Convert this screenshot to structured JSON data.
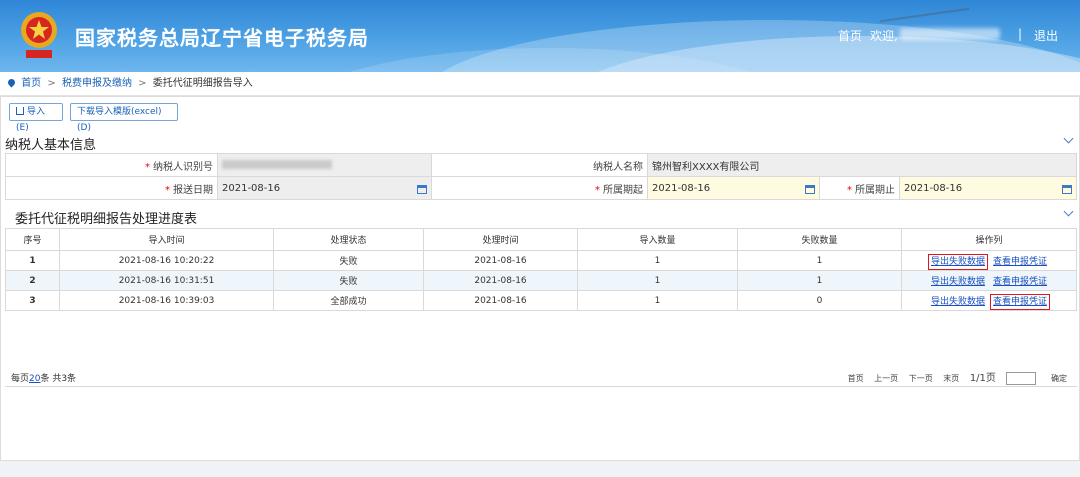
{
  "header": {
    "site_title": "国家税务总局辽宁省电子税务局",
    "nav": {
      "home": "首页",
      "welcome": "欢迎,",
      "separator": "|",
      "exit": "退出"
    }
  },
  "breadcrumb": {
    "items": [
      "首页",
      "税费申报及缴纳"
    ],
    "current": "委托代征明细报告导入"
  },
  "toolbar": {
    "import_label": "导入(E)",
    "template_label": "下载导入模版(excel)(D)"
  },
  "taxpayer_section": {
    "title": "纳税人基本信息",
    "taxpayer_id_label": "纳税人识别号",
    "taxpayer_name_label": "纳税人名称",
    "taxpayer_name_value": "锦州智利XXXX有限公司",
    "report_date_label": "报送日期",
    "report_date_value": "2021-08-16",
    "period_start_label": "所属期起",
    "period_start_value": "2021-08-16",
    "period_end_label": "所属期止",
    "period_end_value": "2021-08-16"
  },
  "progress_section": {
    "title": "委托代征税明细报告处理进度表",
    "columns": [
      "序号",
      "导入时间",
      "处理状态",
      "处理时间",
      "导入数量",
      "失败数量",
      "操作列"
    ],
    "rows": [
      {
        "idx": "1",
        "import_time": "2021-08-16 10:20:22",
        "status": "失败",
        "process_time": "2021-08-16",
        "import_count": "1",
        "fail_count": "1",
        "action1": "导出失败数据",
        "action2": "查看申报凭证"
      },
      {
        "idx": "2",
        "import_time": "2021-08-16 10:31:51",
        "status": "失败",
        "process_time": "2021-08-16",
        "import_count": "1",
        "fail_count": "1",
        "action1": "导出失败数据",
        "action2": "查看申报凭证"
      },
      {
        "idx": "3",
        "import_time": "2021-08-16 10:39:03",
        "status": "全部成功",
        "process_time": "2021-08-16",
        "import_count": "1",
        "fail_count": "0",
        "action1": "导出失败数据",
        "action2": "查看申报凭证"
      }
    ]
  },
  "pager": {
    "per_page_prefix": "每页",
    "per_page_value": "20",
    "per_page_suffix": "条 共3条",
    "first": "首页",
    "prev": "上一页",
    "next": "下一页",
    "last": "末页",
    "page_info": "1/1页",
    "confirm": "确定"
  }
}
